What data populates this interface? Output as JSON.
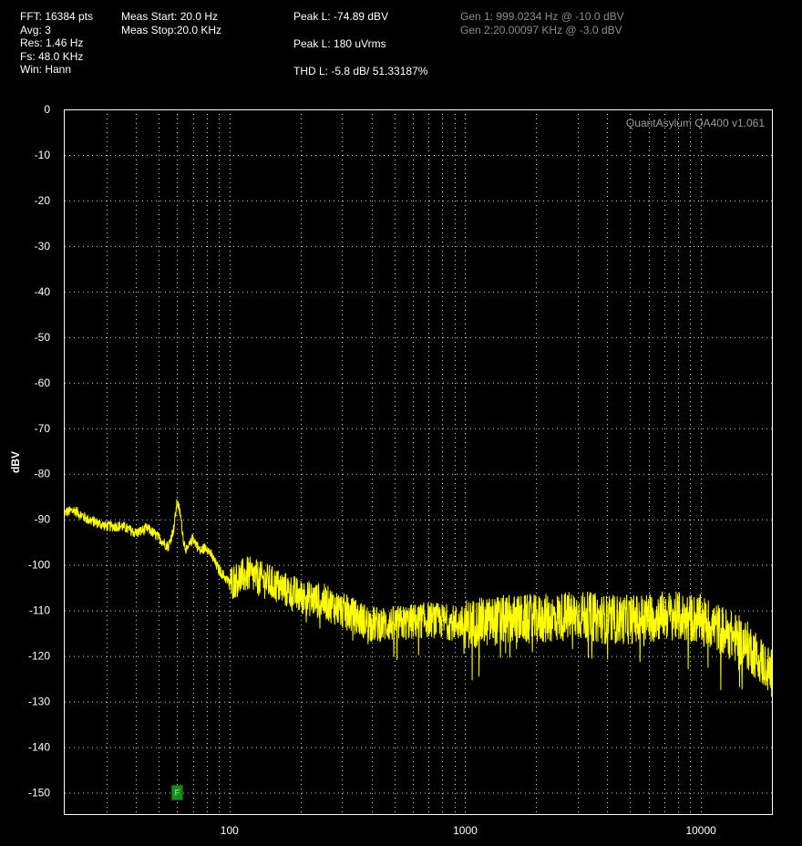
{
  "header": {
    "col1": [
      "FFT: 16384 pts",
      "Avg: 3",
      "Res: 1.46 Hz",
      "Fs: 48.0 KHz",
      "Win: Hann"
    ],
    "col2": [
      "Meas Start: 20.0 Hz",
      "Meas Stop:20.0 KHz"
    ],
    "peak_l_dbv": "Peak L: -74.89 dBV",
    "peak_l_rms": "Peak L: 180 uVrms",
    "thd_l": "THD L: -5.8 dB/ 51.33187%",
    "gen1": "Gen 1: 999.0234 Hz @ -10.0  dBV",
    "gen2": "Gen 2:20.00097 KHz @ -3.0  dBV"
  },
  "brand": "QuantAsylum QA400 v1.061",
  "marker": {
    "label": "F",
    "x": 60,
    "y": -150,
    "color": "#1a8a1a"
  },
  "colors": {
    "trace": "#ffff00",
    "grid": "#cfcfcf",
    "frame": "#ffffff",
    "background": "#000000"
  },
  "chart_data": {
    "type": "line",
    "x_scale": "log",
    "xlim": [
      20,
      20000
    ],
    "ylim": [
      -155,
      0
    ],
    "ylabel": "dBV",
    "xlabel": "",
    "grid": true,
    "y_ticks": [
      0,
      -10,
      -20,
      -30,
      -40,
      -50,
      -60,
      -70,
      -80,
      -90,
      -100,
      -110,
      -120,
      -130,
      -140,
      -150
    ],
    "y_tick_labels": [
      "0",
      "-10",
      "-20",
      "-30",
      "-40",
      "-50",
      "-60",
      "-70",
      "-80",
      "-90",
      "-100",
      "-110",
      "-120",
      "-130",
      "-140",
      "-150"
    ],
    "x_ticks": [
      100,
      1000,
      10000
    ],
    "x_tick_labels": [
      "100",
      "1000",
      "10000"
    ],
    "series": [
      {
        "color": "#ffff00",
        "x": [
          20,
          22,
          25,
          30,
          35,
          40,
          45,
          50,
          55,
          58,
          60,
          62,
          64,
          66,
          70,
          75,
          80,
          90,
          100,
          120,
          150,
          200,
          250,
          300,
          400,
          500,
          700,
          1000,
          1500,
          2000,
          3000,
          4000,
          5000,
          7000,
          10000,
          12000,
          14000,
          16000,
          18000,
          20000
        ],
        "y": [
          -88.5,
          -88,
          -90,
          -91.5,
          -91.5,
          -93,
          -92,
          -94,
          -96,
          -92,
          -86,
          -89,
          -95,
          -97,
          -94,
          -97,
          -96,
          -101,
          -104,
          -102,
          -104,
          -107,
          -108,
          -110,
          -113,
          -113,
          -112,
          -113,
          -112,
          -112,
          -111,
          -112,
          -112,
          -111,
          -112,
          -114,
          -116,
          -118,
          -121,
          -124
        ]
      }
    ]
  }
}
